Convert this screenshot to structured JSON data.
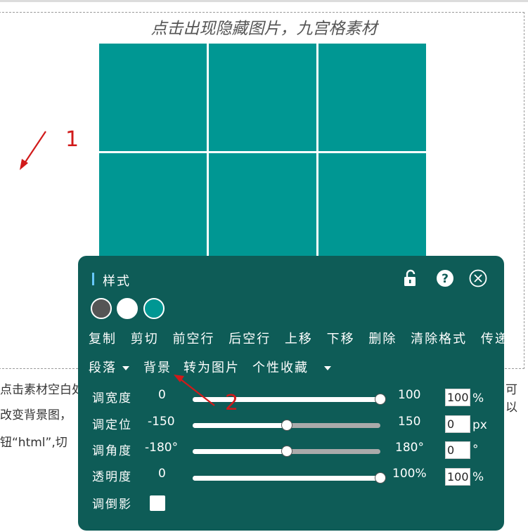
{
  "caption": "点击出现隐藏图片，九宫格素材",
  "annotations": {
    "one": "1",
    "two": "2"
  },
  "body_text": {
    "line1": "点击素材空白处",
    "line1_right": "可以",
    "line2": "改变背景图，",
    "line3": "钮“html”,切"
  },
  "panel": {
    "title": "样式",
    "swatch_colors": [
      "#555555",
      "#ffffff",
      "#009793"
    ],
    "menu_row1": [
      "复制",
      "剪切",
      "前空行",
      "后空行",
      "上移",
      "下移",
      "删除",
      "清除格式",
      "传递"
    ],
    "menu_row2": {
      "paragraph": "段落",
      "background": "背景",
      "to_image": "转为图片",
      "favorites": "个性收藏"
    },
    "controls": [
      {
        "label": "调宽度",
        "min": "0",
        "max": "100",
        "input": "100",
        "unit": "%",
        "fraction": 1.0
      },
      {
        "label": "调定位",
        "min": "-150",
        "max": "150",
        "input": "0",
        "unit": "px",
        "fraction": 0.5
      },
      {
        "label": "调角度",
        "min": "-180°",
        "max": "180°",
        "input": "0",
        "unit": "°",
        "fraction": 0.5
      },
      {
        "label": "透明度",
        "min": "0",
        "max": "100%",
        "input": "100",
        "unit": "%",
        "fraction": 1.0
      }
    ],
    "reflection_label": "调倒影"
  }
}
